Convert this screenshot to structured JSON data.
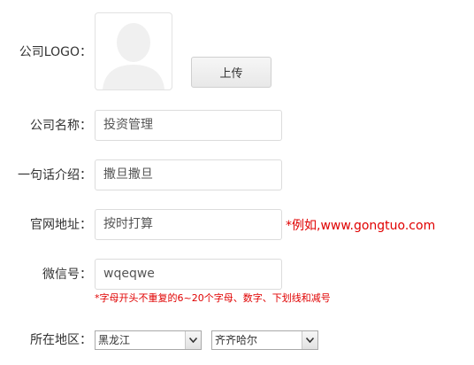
{
  "form": {
    "logo_label": "公司LOGO：",
    "upload_label": "上传",
    "company_name_label": "公司名称：",
    "company_name_value": "投资管理",
    "tagline_label": "一句话介绍：",
    "tagline_value": "撒旦撒旦",
    "website_label": "官网地址：",
    "website_value": "按时打算",
    "website_hint": "*例如,www.gongtuo.com",
    "wechat_label": "微信号：",
    "wechat_value": "wqeqwe",
    "wechat_hint": "*字母开头不重复的6~20个字母、数字、下划线和减号",
    "region_label": "所在地区：",
    "province_value": "黑龙江",
    "city_value": "齐齐哈尔"
  },
  "icons": {
    "logo_placeholder": "person-silhouette-icon",
    "select_arrow": "chevron-down-icon"
  },
  "colors": {
    "hint": "#e00000",
    "border": "#dcdcdc",
    "placeholder_silhouette": "#f0f0f0"
  }
}
